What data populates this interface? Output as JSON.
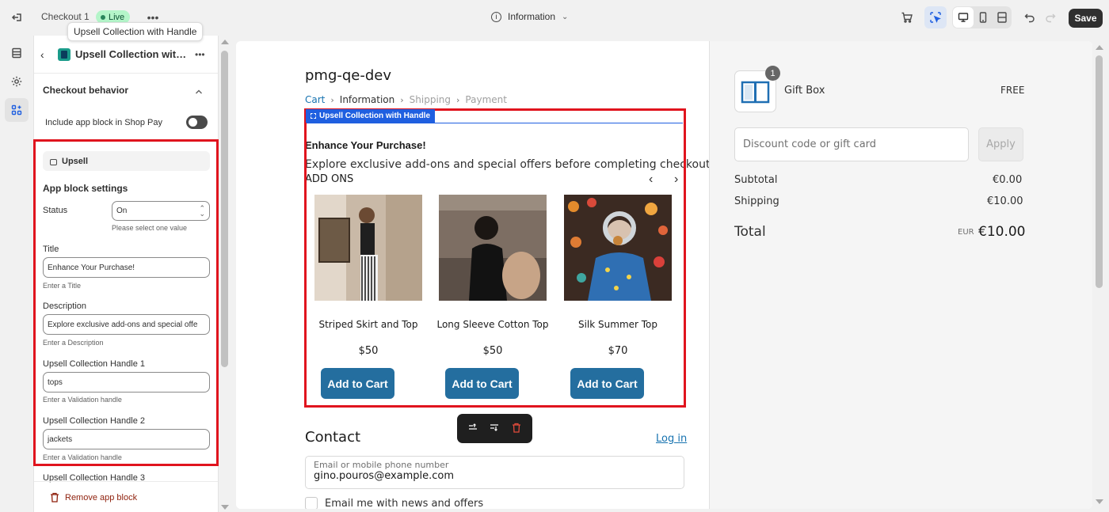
{
  "topbar": {
    "back_icon": "exit-icon",
    "page_name": "Checkout 1",
    "status": "Live",
    "tooltip": "Upsell Collection with Handle",
    "page_selector": "Information",
    "save_label": "Save"
  },
  "rail": {
    "items": [
      "sections-icon",
      "settings-icon",
      "apps-icon"
    ]
  },
  "panel": {
    "title": "Upsell Collection with H...",
    "section": "Checkout behavior",
    "toggle_label": "Include app block in Shop Pay",
    "block_name": "Upsell",
    "settings_heading": "App block settings",
    "status_label": "Status",
    "status_value": "On",
    "status_help": "Please select one value",
    "title_label": "Title",
    "title_value": "Enhance Your Purchase!",
    "title_help": "Enter a Title",
    "desc_label": "Description",
    "desc_value": "Explore exclusive add-ons and special offe",
    "desc_help": "Enter a Description",
    "handle1_label": "Upsell Collection Handle 1",
    "handle1_value": "tops",
    "handle1_help": "Enter a Validation handle",
    "handle2_label": "Upsell Collection Handle 2",
    "handle2_value": "jackets",
    "handle2_help": "Enter a Validation handle",
    "handle3_label": "Upsell Collection Handle 3",
    "remove_label": "Remove app block"
  },
  "checkout": {
    "store_name": "pmg-qe-dev",
    "breadcrumbs": [
      "Cart",
      "Information",
      "Shipping",
      "Payment"
    ],
    "block_label": "Upsell Collection with Handle",
    "upsell_title": "Enhance Your Purchase!",
    "upsell_desc": "Explore exclusive add-ons and special offers before completing checkout.",
    "addons_label": "ADD ONS",
    "products": [
      {
        "name": "Striped Skirt and Top",
        "price": "$50",
        "button": "Add to Cart"
      },
      {
        "name": "Long Sleeve Cotton Top",
        "price": "$50",
        "button": "Add to Cart"
      },
      {
        "name": "Silk Summer Top",
        "price": "$70",
        "button": "Add to Cart"
      }
    ],
    "contact_heading": "Contact",
    "login_link": "Log in",
    "email_label": "Email or mobile phone number",
    "email_value": "gino.pouros@example.com",
    "newsletter_label": "Email me with news and offers"
  },
  "summary": {
    "item_qty": "1",
    "item_name": "Gift Box",
    "item_price": "FREE",
    "discount_placeholder": "Discount code or gift card",
    "apply_label": "Apply",
    "subtotal_label": "Subtotal",
    "subtotal_value": "€0.00",
    "shipping_label": "Shipping",
    "shipping_value": "€10.00",
    "total_label": "Total",
    "currency": "EUR",
    "total_value": "€10.00"
  },
  "colors": {
    "accent": "#246e9f",
    "selection": "#1f5fe0",
    "highlight": "#e0141e",
    "live": "#b4f5c9"
  }
}
